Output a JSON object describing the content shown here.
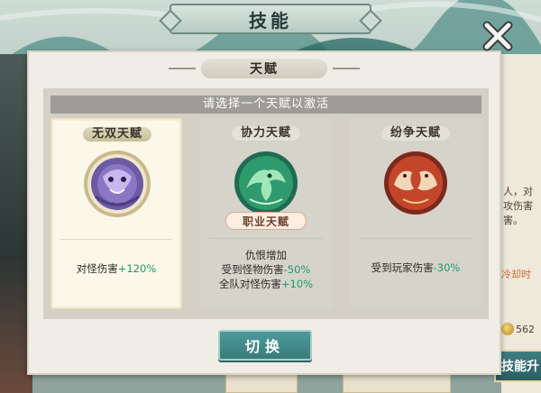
{
  "screen": {
    "title": "技能"
  },
  "dialog": {
    "title": "天赋",
    "prompt": "请选择一个天赋以激活",
    "switch_label": "切换"
  },
  "talents": [
    {
      "name": "无双天赋",
      "selected": true,
      "emblem": "purple-lion-emblem-icon",
      "badge": "",
      "effects": [
        {
          "text": "对怪伤害",
          "value": "+120%"
        }
      ]
    },
    {
      "name": "协力天赋",
      "selected": false,
      "emblem": "green-phoenix-emblem-icon",
      "badge": "职业天赋",
      "effects": [
        {
          "text": "仇恨增加",
          "value": ""
        },
        {
          "text": "受到怪物伤害",
          "value": "-50%"
        },
        {
          "text": "全队对怪伤害",
          "value": "+10%"
        }
      ]
    },
    {
      "name": "纷争天赋",
      "selected": false,
      "emblem": "red-dragon-emblem-icon",
      "badge": "",
      "effects": [
        {
          "text": "受到玩家伤害",
          "value": "-30%"
        }
      ]
    }
  ],
  "background": {
    "right_text_1": "人，对",
    "right_text_2": "攻伤害",
    "right_text_3": "害。",
    "cooldown": "冷却时",
    "coins": "562",
    "skill_button": "技能升"
  },
  "colors": {
    "accent_teal": "#3a7c7c",
    "effect_green": "#1f9a6a",
    "selected_card": "#fbf8ea"
  }
}
